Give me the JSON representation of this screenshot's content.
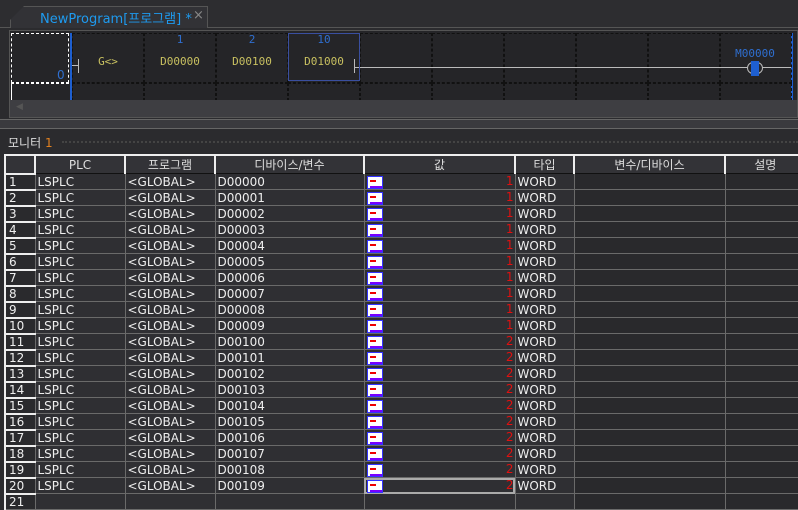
{
  "tab": {
    "title": "NewProgram[프로그램] *",
    "close": "×"
  },
  "ladder": {
    "row_number": "0",
    "contact_label": "G<>",
    "operands": [
      {
        "index": "1",
        "device": "D00000"
      },
      {
        "index": "2",
        "device": "D00100"
      },
      {
        "index": "10",
        "device": "D01000"
      }
    ],
    "coil": "M00000",
    "rail_color": "#1e5fd0"
  },
  "monitor": {
    "title": "모니터",
    "number": "1",
    "columns": [
      "",
      "PLC",
      "프로그램",
      "디바이스/변수",
      "값",
      "타입",
      "변수/디바이스",
      "설명"
    ],
    "rows": [
      {
        "n": "1",
        "plc": "LSPLC",
        "prog": "<GLOBAL>",
        "dev": "D00000",
        "val": "1",
        "type": "WORD"
      },
      {
        "n": "2",
        "plc": "LSPLC",
        "prog": "<GLOBAL>",
        "dev": "D00001",
        "val": "1",
        "type": "WORD"
      },
      {
        "n": "3",
        "plc": "LSPLC",
        "prog": "<GLOBAL>",
        "dev": "D00002",
        "val": "1",
        "type": "WORD"
      },
      {
        "n": "4",
        "plc": "LSPLC",
        "prog": "<GLOBAL>",
        "dev": "D00003",
        "val": "1",
        "type": "WORD"
      },
      {
        "n": "5",
        "plc": "LSPLC",
        "prog": "<GLOBAL>",
        "dev": "D00004",
        "val": "1",
        "type": "WORD"
      },
      {
        "n": "6",
        "plc": "LSPLC",
        "prog": "<GLOBAL>",
        "dev": "D00005",
        "val": "1",
        "type": "WORD"
      },
      {
        "n": "7",
        "plc": "LSPLC",
        "prog": "<GLOBAL>",
        "dev": "D00006",
        "val": "1",
        "type": "WORD"
      },
      {
        "n": "8",
        "plc": "LSPLC",
        "prog": "<GLOBAL>",
        "dev": "D00007",
        "val": "1",
        "type": "WORD"
      },
      {
        "n": "9",
        "plc": "LSPLC",
        "prog": "<GLOBAL>",
        "dev": "D00008",
        "val": "1",
        "type": "WORD"
      },
      {
        "n": "10",
        "plc": "LSPLC",
        "prog": "<GLOBAL>",
        "dev": "D00009",
        "val": "1",
        "type": "WORD"
      },
      {
        "n": "11",
        "plc": "LSPLC",
        "prog": "<GLOBAL>",
        "dev": "D00100",
        "val": "2",
        "type": "WORD"
      },
      {
        "n": "12",
        "plc": "LSPLC",
        "prog": "<GLOBAL>",
        "dev": "D00101",
        "val": "2",
        "type": "WORD"
      },
      {
        "n": "13",
        "plc": "LSPLC",
        "prog": "<GLOBAL>",
        "dev": "D00102",
        "val": "2",
        "type": "WORD"
      },
      {
        "n": "14",
        "plc": "LSPLC",
        "prog": "<GLOBAL>",
        "dev": "D00103",
        "val": "2",
        "type": "WORD"
      },
      {
        "n": "15",
        "plc": "LSPLC",
        "prog": "<GLOBAL>",
        "dev": "D00104",
        "val": "2",
        "type": "WORD"
      },
      {
        "n": "16",
        "plc": "LSPLC",
        "prog": "<GLOBAL>",
        "dev": "D00105",
        "val": "2",
        "type": "WORD"
      },
      {
        "n": "17",
        "plc": "LSPLC",
        "prog": "<GLOBAL>",
        "dev": "D00106",
        "val": "2",
        "type": "WORD"
      },
      {
        "n": "18",
        "plc": "LSPLC",
        "prog": "<GLOBAL>",
        "dev": "D00107",
        "val": "2",
        "type": "WORD"
      },
      {
        "n": "19",
        "plc": "LSPLC",
        "prog": "<GLOBAL>",
        "dev": "D00108",
        "val": "2",
        "type": "WORD"
      },
      {
        "n": "20",
        "plc": "LSPLC",
        "prog": "<GLOBAL>",
        "dev": "D00109",
        "val": "2",
        "type": "WORD",
        "selected": true
      },
      {
        "n": "21",
        "plc": "",
        "prog": "",
        "dev": "",
        "val": "",
        "type": ""
      }
    ]
  }
}
